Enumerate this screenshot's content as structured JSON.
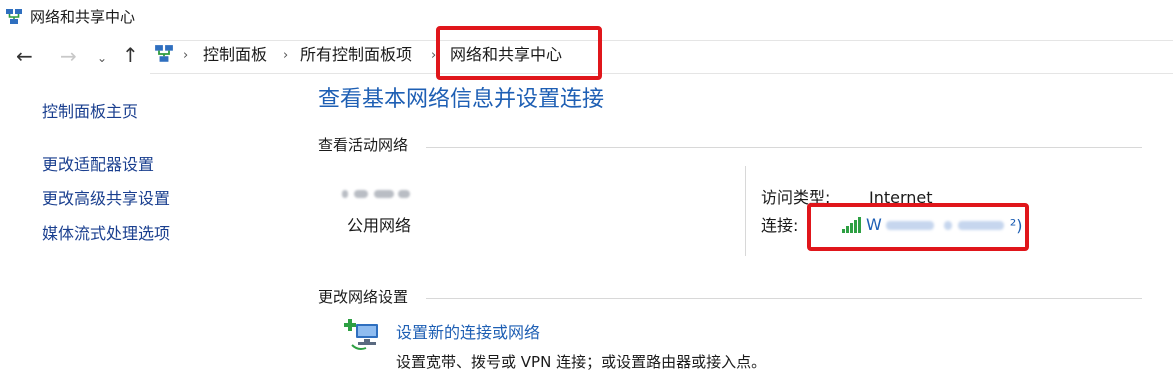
{
  "window": {
    "title": "网络和共享中心"
  },
  "icons": {
    "title_icon": "network-sharing-center-icon",
    "back": "arrow-left-icon",
    "forward": "arrow-right-icon",
    "recent": "chevron-down-icon",
    "up": "arrow-up-icon",
    "address_icon": "network-sharing-center-icon",
    "signal": "wifi-signal-icon",
    "new_connection": "new-connection-icon"
  },
  "nav": {
    "back_glyph": "←",
    "forward_glyph": "→",
    "recent_glyph": "⌄",
    "up_glyph": "↑",
    "separator": "›",
    "breadcrumbs": [
      "控制面板",
      "所有控制面板项",
      "网络和共享中心"
    ]
  },
  "sidebar": {
    "items": [
      {
        "label": "控制面板主页"
      },
      {
        "label": "更改适配器设置"
      },
      {
        "label": "更改高级共享设置"
      },
      {
        "label": "媒体流式处理选项"
      }
    ]
  },
  "main": {
    "title": "查看基本网络信息并设置连接",
    "active_networks": {
      "heading": "查看活动网络",
      "network_category": "公用网络",
      "access_type_label": "访问类型:",
      "access_type_value": "Internet",
      "connection_label": "连接:",
      "connection_text_prefix": "W",
      "connection_text_suffix": "²)"
    },
    "change_settings": {
      "heading": "更改网络设置",
      "new_connection_link": "设置新的连接或网络",
      "new_connection_desc": "设置宽带、拨号或 VPN 连接；或设置路由器或接入点。"
    }
  },
  "colors": {
    "link": "#1e5fb4",
    "side_link": "#1a3f8f",
    "annotation": "#e0161b",
    "signal": "#2ea043"
  }
}
